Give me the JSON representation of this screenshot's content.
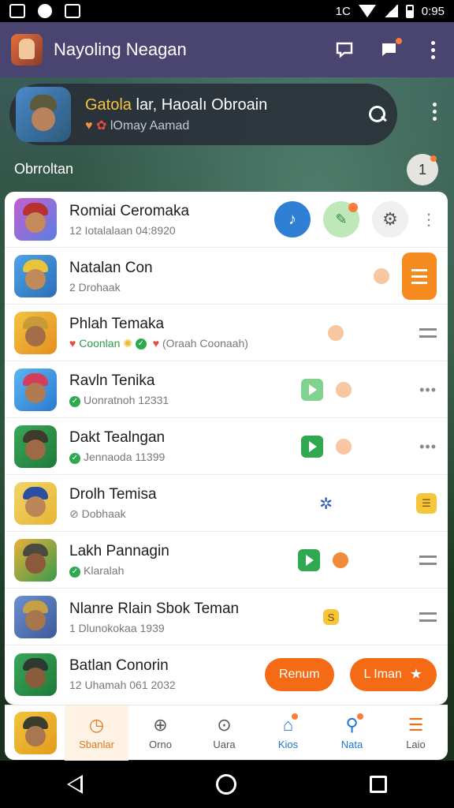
{
  "status_bar": {
    "time": "0:95",
    "network": "1C"
  },
  "app_bar": {
    "title": "Nayoling Neagan"
  },
  "contact": {
    "name_accent": "Gatola",
    "name_rest": " lar, Haoalı Obroain",
    "sub_text": "lOmay Aamad"
  },
  "section": {
    "label": "Obrroltan",
    "count": "1"
  },
  "rows": [
    {
      "title": "Romiai Ceromaka",
      "sub": "12 Iotalalaan 04:8920"
    },
    {
      "title": "Natalan Con",
      "sub": "2 Drohaak"
    },
    {
      "title": "Phlah Temaka",
      "sub_green": "Coonlan",
      "sub_rest": " (Oraah Coonaah)"
    },
    {
      "title": "Ravln Tenika",
      "sub": "Uonratnoh 12331"
    },
    {
      "title": "Dakt Tealngan",
      "sub": "Jennaoda 11399"
    },
    {
      "title": "Drolh Temisa",
      "sub": "Dobhaak"
    },
    {
      "title": "Lakh Pannagin",
      "sub": "Klaralah"
    },
    {
      "title": "Nlanre Rlain Sbok Teman",
      "sub": "1 Dlunokokaa 1939"
    },
    {
      "title": "Batlan Conorin",
      "sub": "12 Uhamah 061 2032"
    }
  ],
  "row_pills": {
    "left": "Renum",
    "right": "L Iman"
  },
  "bottom_nav": [
    {
      "label": "Sbanlar"
    },
    {
      "label": "Orno"
    },
    {
      "label": "Uara"
    },
    {
      "label": "Kios"
    },
    {
      "label": "Nata"
    },
    {
      "label": "Laio"
    }
  ],
  "colors": {
    "app_bar": "#4a4570",
    "accent_orange": "#f46a15",
    "accent_blue": "#1f73d8",
    "accent_green": "#2fa84f"
  }
}
